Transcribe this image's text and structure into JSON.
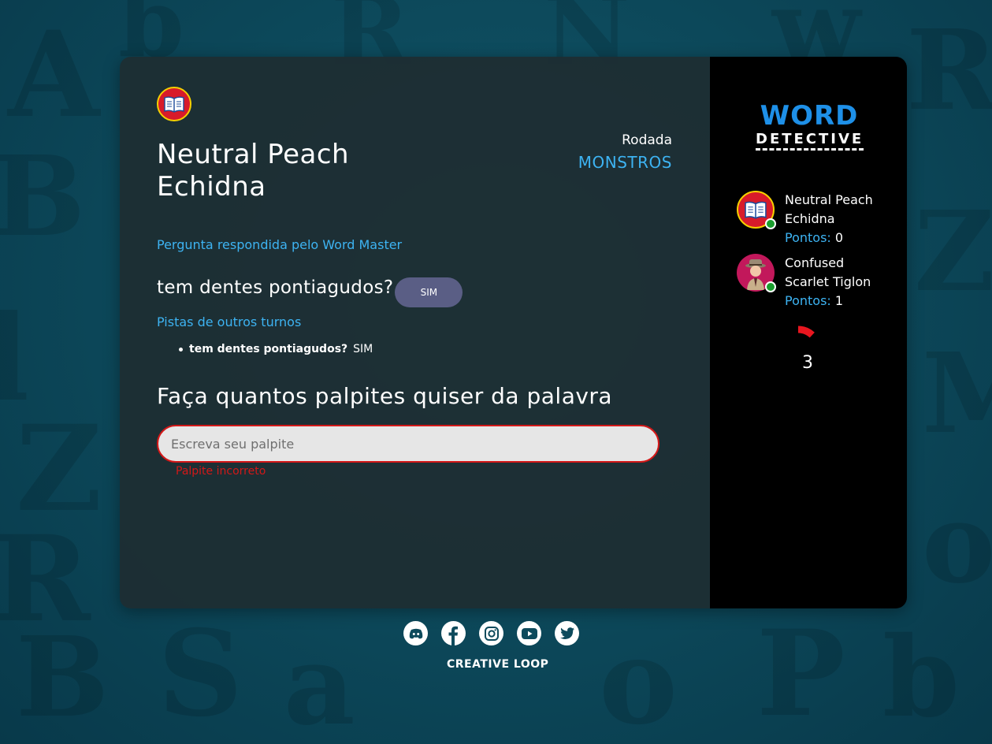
{
  "game": {
    "player_name": "Neutral Peach Echidna",
    "round_label": "Rodada",
    "round_value": "MONSTROS",
    "answered_by_label": "Pergunta respondida pelo Word Master",
    "question": "tem dentes pontiagudos?",
    "answer": "SIM",
    "clues_title": "Pistas de outros turnos",
    "clues": [
      {
        "question": "tem dentes pontiagudos?",
        "answer": "SIM"
      }
    ],
    "guess_title": "Faça quantos palpites quiser da palavra",
    "guess_placeholder": "Escreva seu palpite",
    "guess_error": "Palpite incorreto"
  },
  "sidebar": {
    "logo_top": "WORD",
    "logo_bottom": "DETECTIVE",
    "players": [
      {
        "name": "Neutral Peach Echidna",
        "points_label": "Pontos:",
        "points": "0",
        "avatar": "book-icon"
      },
      {
        "name": "Confused Scarlet Tiglon",
        "points_label": "Pontos:",
        "points": "1",
        "avatar": "detective-icon"
      }
    ],
    "timer_value": "3",
    "timer_fraction": 0.12
  },
  "footer": {
    "social": [
      "discord-icon",
      "facebook-icon",
      "instagram-icon",
      "youtube-icon",
      "twitter-icon"
    ],
    "brand": "CREATIVE LOOP"
  },
  "colors": {
    "accent": "#3db3f2",
    "error": "#d31818",
    "pill": "#5a5e85",
    "logo_blue": "#1e90e8",
    "online": "#1a9d2e",
    "timer": "#e8161f"
  }
}
